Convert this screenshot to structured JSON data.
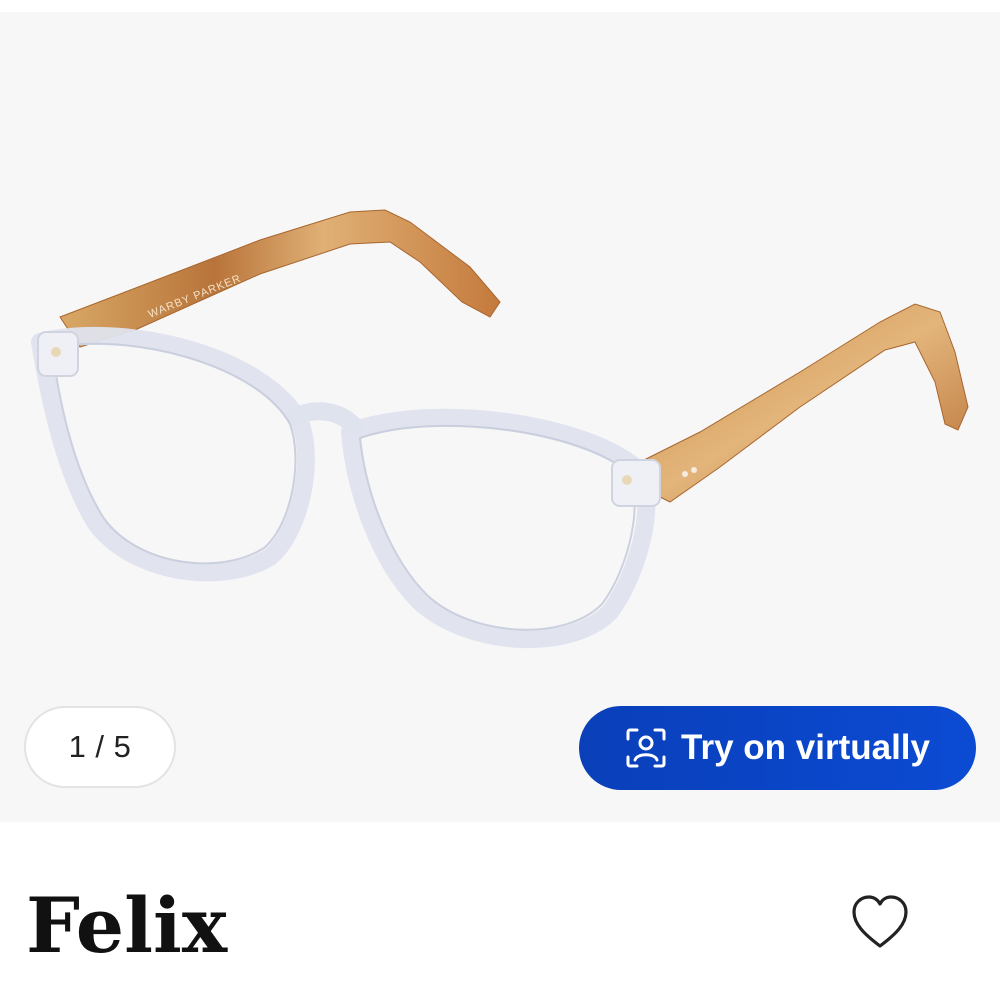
{
  "gallery": {
    "brand_engraving": "WARBY PARKER",
    "image_counter": "1 / 5",
    "try_on_label": "Try on virtually",
    "try_on_icon": "face-scan-icon"
  },
  "product": {
    "name": "Felix",
    "favorite_icon": "heart-outline-icon"
  },
  "colors": {
    "accent": "#0b47c8",
    "frame_clear": "#e6e9f2",
    "temple_tortoise": "#c98a45"
  }
}
